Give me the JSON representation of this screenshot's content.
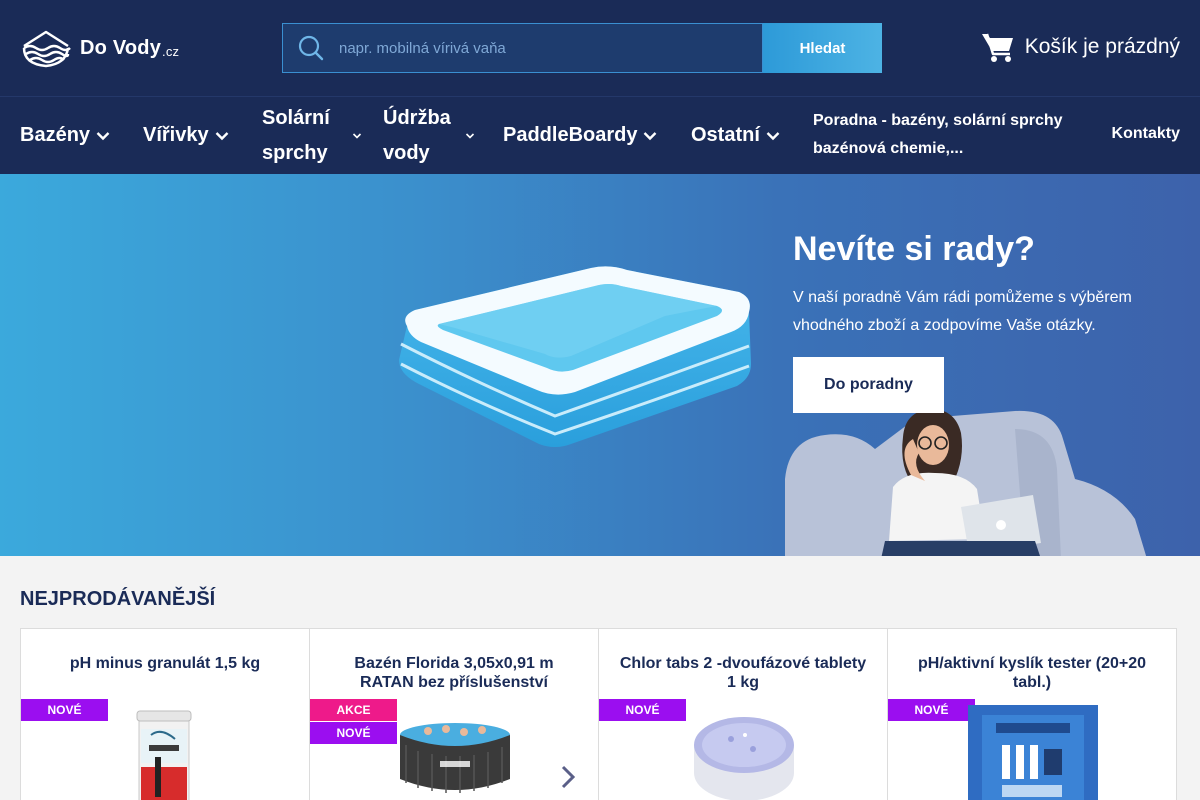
{
  "header": {
    "logo_text": "Do Vody",
    "logo_tld": ".cz",
    "search_placeholder": "napr. mobilná vírivá vaňa",
    "search_button": "Hledat",
    "cart_label": "Košík je prázdný"
  },
  "nav": {
    "items": [
      {
        "label": "Bazény"
      },
      {
        "label": "Vířivky"
      },
      {
        "label_line1": "Solární",
        "label_line2": "sprchy"
      },
      {
        "label_line1": "Údržba",
        "label_line2": "vody"
      },
      {
        "label": "PaddleBoardy"
      },
      {
        "label": "Ostatní"
      }
    ],
    "poradna_line1": "Poradna - bazény, solární sprchy",
    "poradna_line2": "bazénová chemie,...",
    "kontakty": "Kontakty"
  },
  "hero": {
    "title": "Nevíte si rady?",
    "text": "V naší poradně Vám rádi pomůžeme s výběrem vhodného zboží a zodpovíme Vaše otázky.",
    "button": "Do poradny"
  },
  "bestsellers": {
    "title": "NEJPRODÁVANĚJŠÍ",
    "products": [
      {
        "name": "pH minus granulát 1,5 kg",
        "badges": [
          "NOVÉ"
        ]
      },
      {
        "name": "Bazén Florida 3,05x0,91 m RATAN bez příslušenství",
        "badges": [
          "AKCE",
          "NOVÉ"
        ]
      },
      {
        "name": "Chlor tabs 2 -dvoufázové tablety 1 kg",
        "badges": [
          "NOVÉ"
        ]
      },
      {
        "name": "pH/aktivní kyslík tester (20+20 tabl.)",
        "badges": [
          "NOVÉ"
        ]
      }
    ]
  },
  "colors": {
    "header_bg": "#1a2b57",
    "accent_blue": "#2d9ad8",
    "badge_new": "#9b0ef0",
    "badge_sale": "#ee1a8a"
  },
  "icons": [
    "logo-waves-icon",
    "search-icon",
    "cart-icon",
    "chevron-down-icon",
    "chevron-right-icon"
  ]
}
